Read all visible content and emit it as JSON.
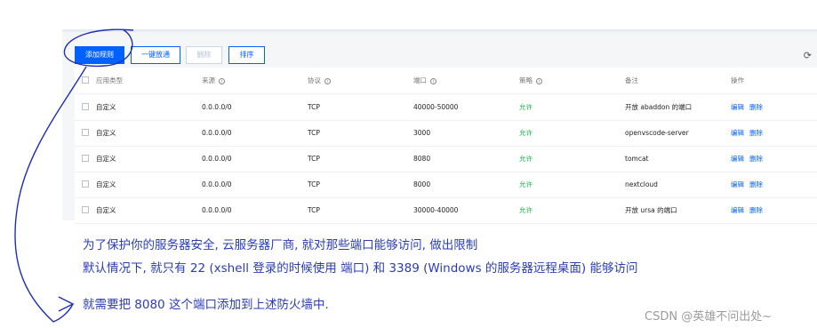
{
  "toolbar": {
    "add_rule": "添加规则",
    "one_click_allow": "一键放通",
    "delete": "删除",
    "sort": "排序"
  },
  "table": {
    "headers": {
      "app_type": "应用类型",
      "source": "来源",
      "protocol": "协议",
      "port": "端口",
      "policy": "策略",
      "remark": "备注",
      "action": "操作"
    },
    "rows": [
      {
        "app_type": "自定义",
        "source": "0.0.0.0/0",
        "protocol": "TCP",
        "port": "40000-50000",
        "policy": "允许",
        "remark": "开放 abaddon 的端口",
        "edit": "编辑",
        "delete": "删除"
      },
      {
        "app_type": "自定义",
        "source": "0.0.0.0/0",
        "protocol": "TCP",
        "port": "3000",
        "policy": "允许",
        "remark": "openvscode-server",
        "edit": "编辑",
        "delete": "删除"
      },
      {
        "app_type": "自定义",
        "source": "0.0.0.0/0",
        "protocol": "TCP",
        "port": "8080",
        "policy": "允许",
        "remark": "tomcat",
        "edit": "编辑",
        "delete": "删除"
      },
      {
        "app_type": "自定义",
        "source": "0.0.0.0/0",
        "protocol": "TCP",
        "port": "8000",
        "policy": "允许",
        "remark": "nextcloud",
        "edit": "编辑",
        "delete": "删除"
      },
      {
        "app_type": "自定义",
        "source": "0.0.0.0/0",
        "protocol": "TCP",
        "port": "30000-40000",
        "policy": "允许",
        "remark": "开放 ursa 的端口",
        "edit": "编辑",
        "delete": "删除"
      }
    ]
  },
  "notes": {
    "line1": "为了保护你的服务器安全, 云服务器厂商, 就对那些端口能够访问, 做出限制",
    "line2": "默认情况下, 就只有 22 (xshell 登录的时候使用 端口) 和 3389 (Windows 的服务器远程桌面)    能够访问",
    "line3": "就需要把 8080 这个端口添加到上述防火墙中."
  },
  "watermark": "CSDN @英雄不问出处~",
  "colors": {
    "accent": "#0061ff",
    "allow": "#19b34a",
    "annotation": "#2a3db8"
  },
  "icons": {
    "refresh": "refresh-icon",
    "info": "info-icon"
  }
}
